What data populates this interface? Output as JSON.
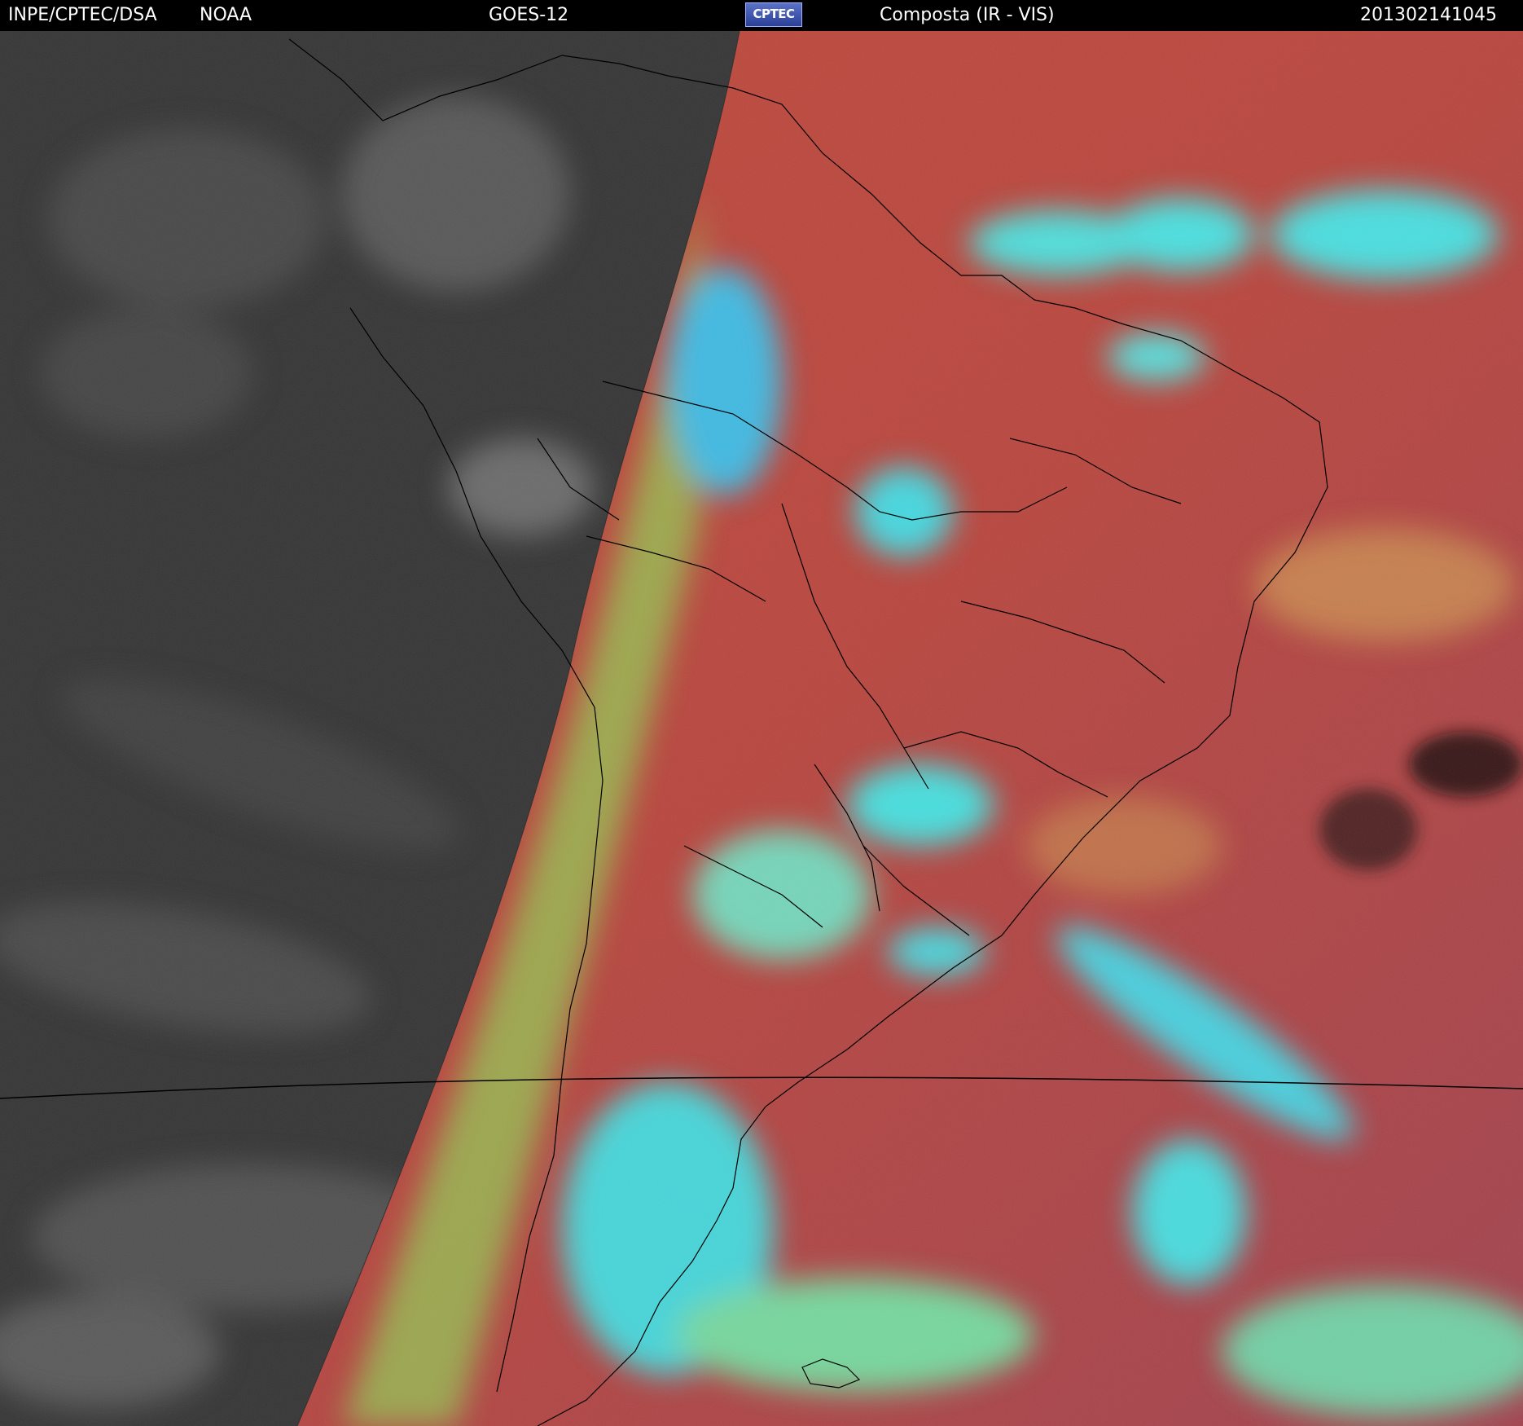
{
  "header": {
    "organization": "INPE/CPTEC/DSA",
    "source": "NOAA",
    "satellite": "GOES-12",
    "logo_text": "CPTEC",
    "product": "Composta (IR - VIS)",
    "timestamp": "201302141045"
  },
  "colors": {
    "night_ir_gray": "#3a3a3a",
    "day_surface_red": "#b8473e",
    "cloud_cyan": "#38e6f0",
    "cloud_green": "#8ee060",
    "border_line": "#000000",
    "header_background": "#000000",
    "header_text": "#ffffff"
  },
  "icons": {
    "logo": "cptec-logo"
  }
}
